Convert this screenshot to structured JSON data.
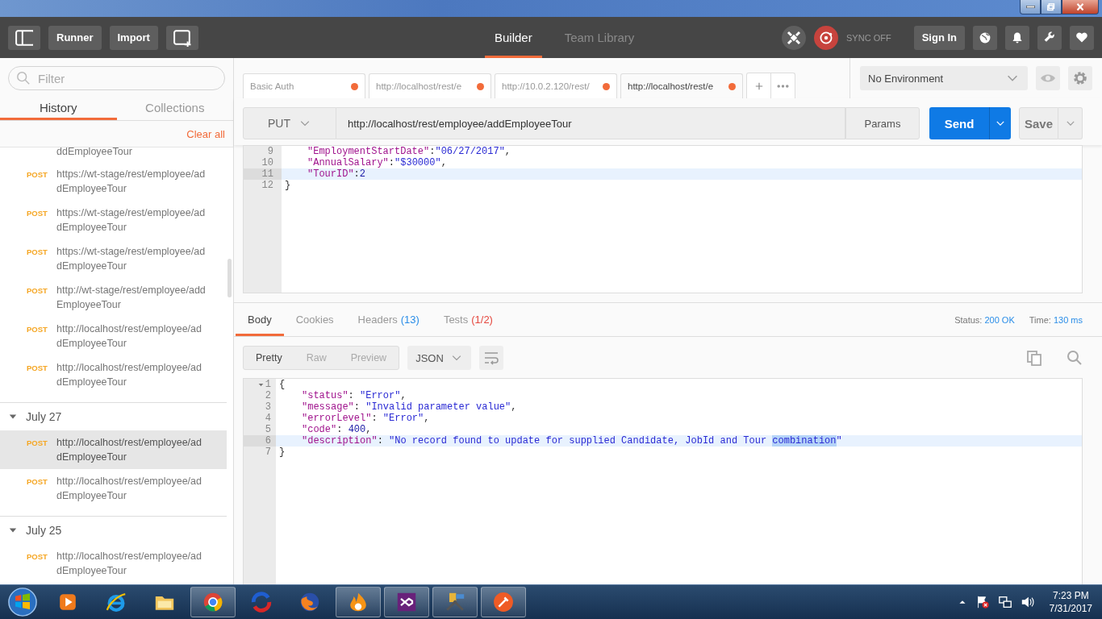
{
  "header": {
    "buttons": [
      {
        "label": "Runner"
      },
      {
        "label": "Import"
      }
    ],
    "tabs": [
      {
        "label": "Builder",
        "selected": true
      },
      {
        "label": "Team Library",
        "selected": false
      }
    ],
    "sync_status": "SYNC OFF",
    "sign_in": "Sign In"
  },
  "sidebar": {
    "filter": {
      "placeholder": "Filter"
    },
    "tabs": [
      {
        "label": "History",
        "selected": true
      },
      {
        "label": "Collections",
        "selected": false
      }
    ],
    "clear_all": "Clear all",
    "cut_line": "ddEmployeeTour",
    "top_items": [
      {
        "method": "POST",
        "url": "https://wt-stage/rest/employee/addEmployeeTour",
        "selected": false
      },
      {
        "method": "POST",
        "url": "https://wt-stage/rest/employee/addEmployeeTour",
        "selected": false
      },
      {
        "method": "POST",
        "url": "https://wt-stage/rest/employee/addEmployeeTour",
        "selected": false
      },
      {
        "method": "POST",
        "url": "http://wt-stage/rest/employee/addEmployeeTour",
        "selected": false
      },
      {
        "method": "POST",
        "url": "http://localhost/rest/employee/addEmployeeTour",
        "selected": false
      },
      {
        "method": "POST",
        "url": "http://localhost/rest/employee/addEmployeeTour",
        "selected": false
      }
    ],
    "groups": [
      {
        "date": "July 27",
        "expanded": true,
        "items": [
          {
            "method": "POST",
            "url": "http://localhost/rest/employee/addEmployeeTour",
            "selected": true
          },
          {
            "method": "POST",
            "url": "http://localhost/rest/employee/addEmployeeTour",
            "selected": false
          }
        ]
      },
      {
        "date": "July 25",
        "expanded": true,
        "items": [
          {
            "method": "POST",
            "url": "http://localhost/rest/employee/addEmployeeTour",
            "selected": false
          }
        ]
      }
    ]
  },
  "request_tabs": [
    {
      "title": "Basic Auth",
      "unsaved": true,
      "selected": false
    },
    {
      "title": "http://localhost/rest/e",
      "unsaved": true,
      "selected": false
    },
    {
      "title": "http://10.0.2.120/rest/",
      "unsaved": true,
      "selected": false
    },
    {
      "title": "http://localhost/rest/e",
      "unsaved": true,
      "selected": true
    }
  ],
  "environment": {
    "value": "No Environment"
  },
  "request": {
    "method": "PUT",
    "url": "http://localhost/rest/employee/addEmployeeTour",
    "params": "Params",
    "send": "Send",
    "save": "Save"
  },
  "body_editor": {
    "lines": [
      {
        "number": "9",
        "active": false,
        "tokens": [
          {
            "kind": "key",
            "text": "\"EmploymentStartDate\""
          },
          {
            "kind": "punct",
            "text": ":"
          },
          {
            "kind": "string",
            "text": "\"06/27/2017\""
          },
          {
            "kind": "punct",
            "text": ","
          }
        ]
      },
      {
        "number": "10",
        "active": false,
        "tokens": [
          {
            "kind": "key",
            "text": "\"AnnualSalary\""
          },
          {
            "kind": "punct",
            "text": ":"
          },
          {
            "kind": "string",
            "text": "\"$30000\""
          },
          {
            "kind": "punct",
            "text": ","
          }
        ]
      },
      {
        "number": "11",
        "active": true,
        "tokens": [
          {
            "kind": "key",
            "text": "\"TourID\""
          },
          {
            "kind": "punct",
            "text": ":"
          },
          {
            "kind": "number",
            "text": "2"
          }
        ]
      },
      {
        "number": "12",
        "active": false,
        "tokens": [
          {
            "kind": "punct",
            "text": "}"
          }
        ]
      }
    ]
  },
  "response": {
    "tabs": [
      {
        "label": "Body",
        "selected": true
      },
      {
        "label": "Cookies",
        "selected": false
      },
      {
        "label": "Headers",
        "count": "(13)",
        "color": "#2a8de8",
        "selected": false
      },
      {
        "label": "Tests",
        "count": "(1/2)",
        "color": "#e5483f",
        "selected": false
      }
    ],
    "status": {
      "label": "Status:",
      "value": "200 OK"
    },
    "time": {
      "label": "Time:",
      "value": "130 ms"
    },
    "view_modes": [
      {
        "label": "Pretty",
        "selected": true
      },
      {
        "label": "Raw",
        "selected": false
      },
      {
        "label": "Preview",
        "selected": false
      }
    ],
    "format": "JSON",
    "lines": [
      {
        "number": "1",
        "active": false,
        "expanded": true,
        "tokens": [
          {
            "kind": "punct",
            "text": "{"
          }
        ]
      },
      {
        "number": "2",
        "active": false,
        "tokens": [
          {
            "kind": "key",
            "text": "\"status\""
          },
          {
            "kind": "punct",
            "text": ": "
          },
          {
            "kind": "string",
            "text": "\"Error\""
          },
          {
            "kind": "punct",
            "text": ","
          }
        ]
      },
      {
        "number": "3",
        "active": false,
        "tokens": [
          {
            "kind": "key",
            "text": "\"message\""
          },
          {
            "kind": "punct",
            "text": ": "
          },
          {
            "kind": "string",
            "text": "\"Invalid parameter value\""
          },
          {
            "kind": "punct",
            "text": ","
          }
        ]
      },
      {
        "number": "4",
        "active": false,
        "tokens": [
          {
            "kind": "key",
            "text": "\"errorLevel\""
          },
          {
            "kind": "punct",
            "text": ": "
          },
          {
            "kind": "string",
            "text": "\"Error\""
          },
          {
            "kind": "punct",
            "text": ","
          }
        ]
      },
      {
        "number": "5",
        "active": false,
        "tokens": [
          {
            "kind": "key",
            "text": "\"code\""
          },
          {
            "kind": "punct",
            "text": ": "
          },
          {
            "kind": "number",
            "text": "400"
          },
          {
            "kind": "punct",
            "text": ","
          }
        ]
      },
      {
        "number": "6",
        "active": true,
        "tokens": [
          {
            "kind": "key",
            "text": "\"description\""
          },
          {
            "kind": "punct",
            "text": ": "
          },
          {
            "kind": "string",
            "text": "\"No record found to update for supplied Candidate, JobId and Tour "
          },
          {
            "kind": "selection",
            "text": "combination"
          },
          {
            "kind": "string",
            "text": "\""
          }
        ]
      },
      {
        "number": "7",
        "active": false,
        "tokens": [
          {
            "kind": "punct",
            "text": "}"
          }
        ]
      }
    ]
  },
  "taskbar": {
    "apps": [
      {
        "kind": "media",
        "open": false
      },
      {
        "kind": "ie",
        "open": false
      },
      {
        "kind": "folder",
        "open": false
      },
      {
        "kind": "chrome",
        "open": true
      },
      {
        "kind": "sync",
        "open": false
      },
      {
        "kind": "firefox",
        "open": false
      },
      {
        "kind": "flame",
        "open": true
      },
      {
        "kind": "vs",
        "open": true
      },
      {
        "kind": "tools",
        "open": true
      },
      {
        "kind": "postman",
        "open": true
      }
    ],
    "clock": {
      "time": "7:23 PM",
      "date": "7/31/2017"
    }
  }
}
